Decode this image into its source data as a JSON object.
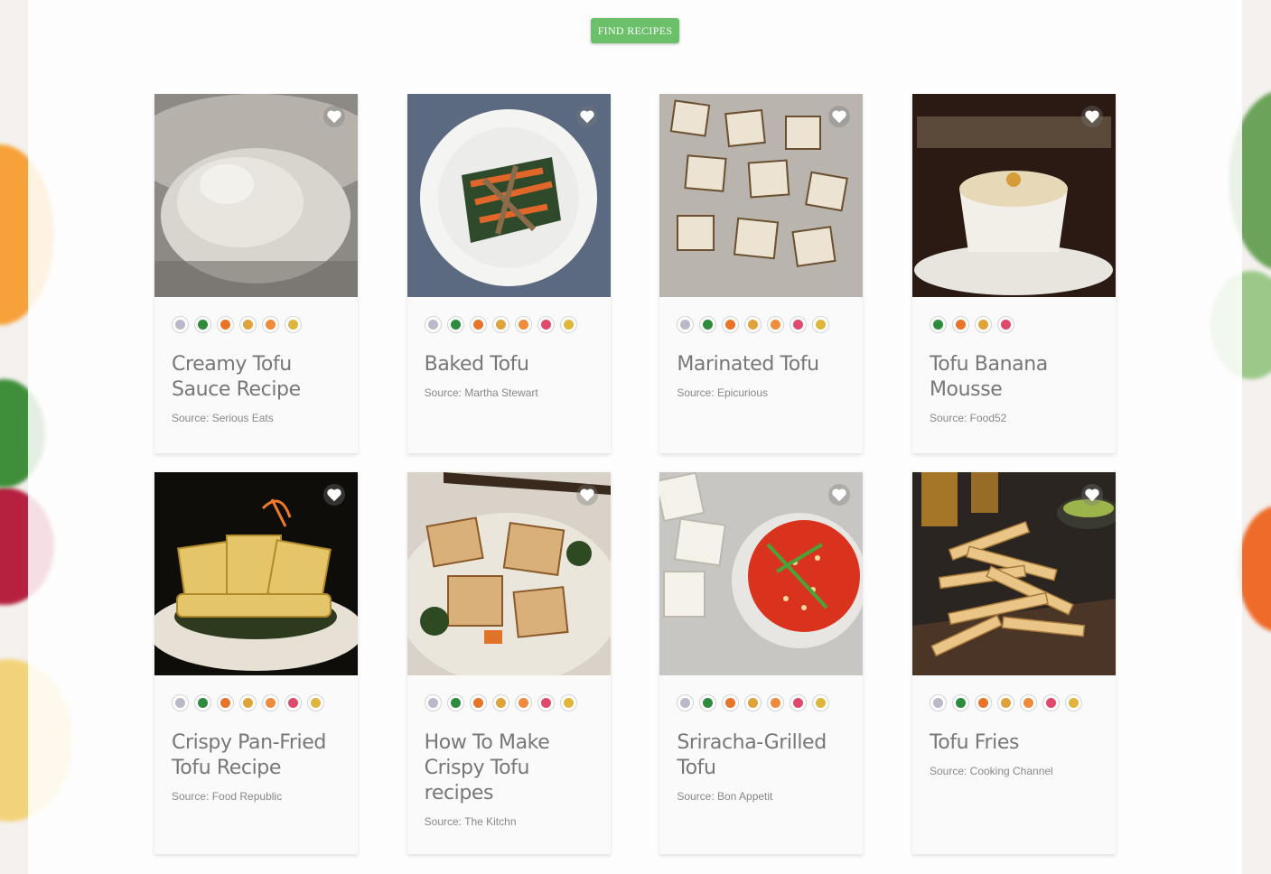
{
  "toolbar": {
    "find_label": "FIND RECIPES"
  },
  "colors": {
    "accent": "#6cc06a",
    "diet_icons": [
      "#b9b9c9",
      "#2e8b3e",
      "#e8742a",
      "#e0a33a",
      "#ef8b3a",
      "#e04a6a",
      "#e0b63a"
    ]
  },
  "recipes": [
    {
      "title": "Creamy Tofu Sauce Recipe",
      "source": "Source: Serious Eats",
      "diet_count": 6,
      "diet_icons": [
        "vegan-icon",
        "broccoli-icon",
        "carrot-icon",
        "peanut-icon",
        "fire-icon",
        "no-wheat-icon"
      ]
    },
    {
      "title": "Baked Tofu",
      "source": "Source: Martha Stewart",
      "diet_count": 7,
      "diet_icons": [
        "vegan-icon",
        "broccoli-icon",
        "carrot-icon",
        "peanut-icon",
        "fire-icon",
        "heart-icon",
        "no-wheat-icon"
      ]
    },
    {
      "title": "Marinated Tofu",
      "source": "Source: Epicurious",
      "diet_count": 7,
      "diet_icons": [
        "vegan-icon",
        "broccoli-icon",
        "carrot-icon",
        "peanut-icon",
        "fire-icon",
        "heart-icon",
        "no-wheat-icon"
      ]
    },
    {
      "title": "Tofu Banana Mousse",
      "source": "Source: Food52",
      "diet_count": 4,
      "diet_icons": [
        "broccoli-icon",
        "carrot-icon",
        "peanut-icon",
        "heart-icon"
      ]
    },
    {
      "title": "Crispy Pan-Fried Tofu Recipe",
      "source": "Source: Food Republic",
      "diet_count": 7,
      "diet_icons": [
        "vegan-icon",
        "broccoli-icon",
        "carrot-icon",
        "peanut-icon",
        "fire-icon",
        "heart-icon",
        "no-wheat-icon"
      ]
    },
    {
      "title": "How To Make Crispy Tofu recipes",
      "source": "Source: The Kitchn",
      "diet_count": 7,
      "diet_icons": [
        "vegan-icon",
        "broccoli-icon",
        "carrot-icon",
        "peanut-icon",
        "fire-icon",
        "heart-icon",
        "no-wheat-icon"
      ]
    },
    {
      "title": "Sriracha-Grilled Tofu",
      "source": "Source: Bon Appetit",
      "diet_count": 7,
      "diet_icons": [
        "vegan-icon",
        "broccoli-icon",
        "carrot-icon",
        "peanut-icon",
        "fire-icon",
        "heart-icon",
        "no-wheat-icon"
      ]
    },
    {
      "title": "Tofu Fries",
      "source": "Source: Cooking Channel",
      "diet_count": 7,
      "diet_icons": [
        "vegan-icon",
        "broccoli-icon",
        "carrot-icon",
        "peanut-icon",
        "fire-icon",
        "heart-icon",
        "no-wheat-icon"
      ]
    }
  ]
}
